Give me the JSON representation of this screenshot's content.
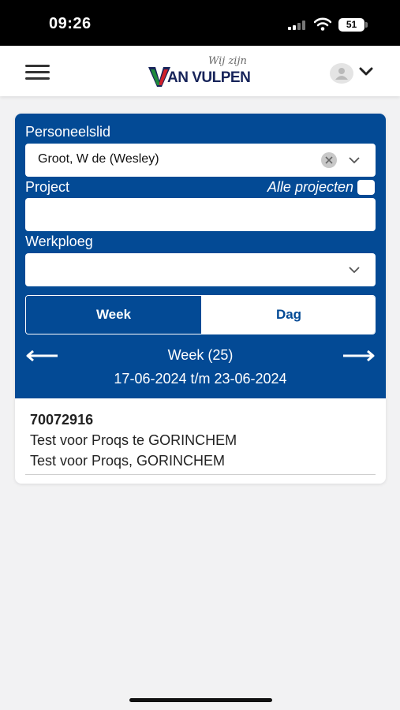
{
  "status_bar": {
    "time": "09:26",
    "battery": "51"
  },
  "header": {
    "logo_tagline": "Wij zijn",
    "logo_text": "AN VULPEN",
    "brand_colors": {
      "navy": "#17245a",
      "green": "#1e8a3c",
      "red": "#d0202a"
    }
  },
  "form": {
    "personeelslid_label": "Personeelslid",
    "personeelslid_value": "Groot, W de (Wesley)",
    "project_label": "Project",
    "alle_projecten_label": "Alle projecten",
    "project_value": "",
    "werkploeg_label": "Werkploeg",
    "werkploeg_value": ""
  },
  "toggle": {
    "week_label": "Week",
    "dag_label": "Dag",
    "selected": "Week"
  },
  "period": {
    "week_label": "Week (25)",
    "range": "17-06-2024 t/m 23-06-2024"
  },
  "results": [
    {
      "id": "70072916",
      "line1": "Test voor Proqs te GORINCHEM",
      "line2": "Test voor Proqs, GORINCHEM"
    }
  ],
  "colors": {
    "primary_blue": "#034a95",
    "background": "#f2f2f3"
  },
  "icons": {
    "menu": "hamburger-menu-icon",
    "user": "user-avatar-icon",
    "dropdown": "chevron-down-icon",
    "clear": "clear-x-icon",
    "prev": "arrow-left-icon",
    "next": "arrow-right-icon"
  }
}
